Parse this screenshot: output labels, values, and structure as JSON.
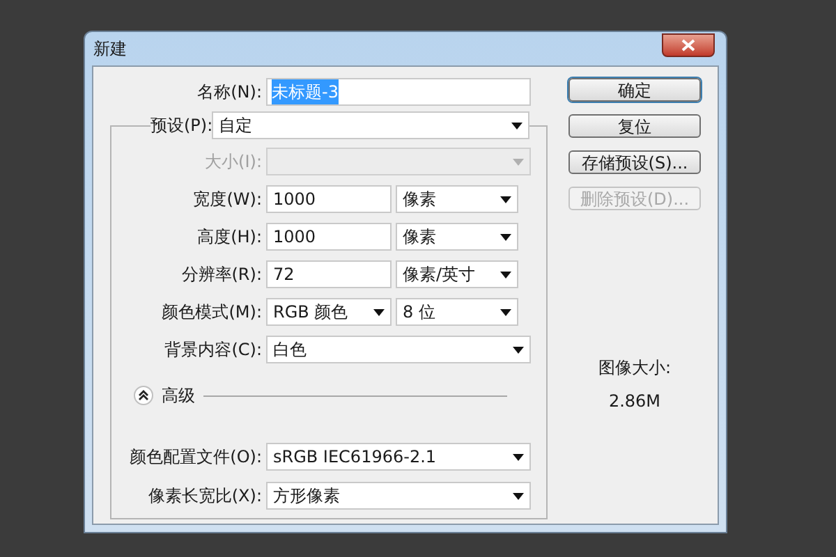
{
  "window": {
    "title": "新建"
  },
  "name_field": {
    "label": "名称(N):",
    "value": "未标题-3",
    "selected": true
  },
  "preset": {
    "label": "预设(P):",
    "value": "自定"
  },
  "rows": [
    {
      "label": "大小(I):",
      "kind": "select",
      "disabled": true
    },
    {
      "label": "宽度(W):",
      "kind": "text",
      "value": "1000",
      "unit": "像素",
      "disabled": false
    },
    {
      "label": "高度(H):",
      "kind": "text",
      "value": "1000",
      "unit": "像素",
      "disabled": false
    },
    {
      "label": "分辨率(R):",
      "kind": "text",
      "value": "72",
      "unit": "像素/英寸",
      "disabled": false
    },
    {
      "label": "颜色模式(M):",
      "kind": "select",
      "value": "RGB 颜色",
      "unit": "8 位",
      "disabled": false
    },
    {
      "label": "背景内容(C):",
      "kind": "select",
      "value": "白色",
      "disabled": false
    }
  ],
  "advanced": {
    "label": "高级",
    "expanded": true
  },
  "advanced_rows": [
    {
      "label": "颜色配置文件(O):",
      "kind": "select",
      "value": "sRGB IEC61966-2.1",
      "disabled": false
    },
    {
      "label": "像素长宽比(X):",
      "kind": "select",
      "value": "方形像素",
      "disabled": false
    }
  ],
  "buttons": [
    {
      "label": "确定",
      "default": true,
      "disabled": false
    },
    {
      "label": "复位",
      "default": false,
      "disabled": false
    },
    {
      "label": "存储预设(S)...",
      "default": false,
      "disabled": false
    },
    {
      "label": "删除预设(D)...",
      "default": false,
      "disabled": true
    }
  ],
  "image_size": {
    "label": "图像大小:",
    "value": "2.86M"
  }
}
